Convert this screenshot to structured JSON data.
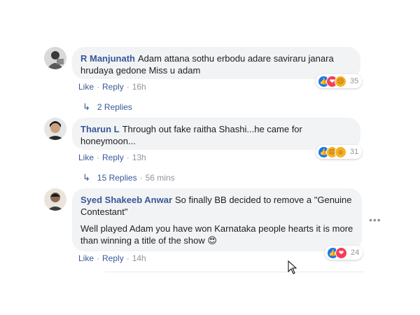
{
  "comments": [
    {
      "author": "R Manjunath",
      "text": "Adam attana sothu erbodu adare saviraru janara hrudaya gedone Miss u adam",
      "like_label": "Like",
      "reply_label": "Reply",
      "time": "16h",
      "reaction_count": "35",
      "reactions": [
        "like-icon",
        "love-icon",
        "angry-icon"
      ],
      "replies_label": "2 Replies",
      "replies_time": ""
    },
    {
      "author": "Tharun L",
      "text": "Through out fake raitha Shashi...he came for honeymoon...",
      "like_label": "Like",
      "reply_label": "Reply",
      "time": "13h",
      "reaction_count": "31",
      "reactions": [
        "like-icon",
        "angry-icon",
        "haha-icon"
      ],
      "replies_label": "15 Replies",
      "replies_time": "56 mins"
    },
    {
      "author": "Syed Shakeeb Anwar",
      "text": "So finally BB decided to remove a \"Genuine Contestant\"",
      "text2": "Well played Adam you have won Karnataka people hearts it is more than winning a title of the show",
      "emoji": "😍",
      "like_label": "Like",
      "reply_label": "Reply",
      "time": "14h",
      "reaction_count": "24",
      "reactions": [
        "like-icon",
        "love-icon"
      ]
    }
  ],
  "colors": {
    "link": "#385898",
    "bubble": "#f2f3f5",
    "meta": "#90949c"
  },
  "more_icon": "more-options-icon"
}
